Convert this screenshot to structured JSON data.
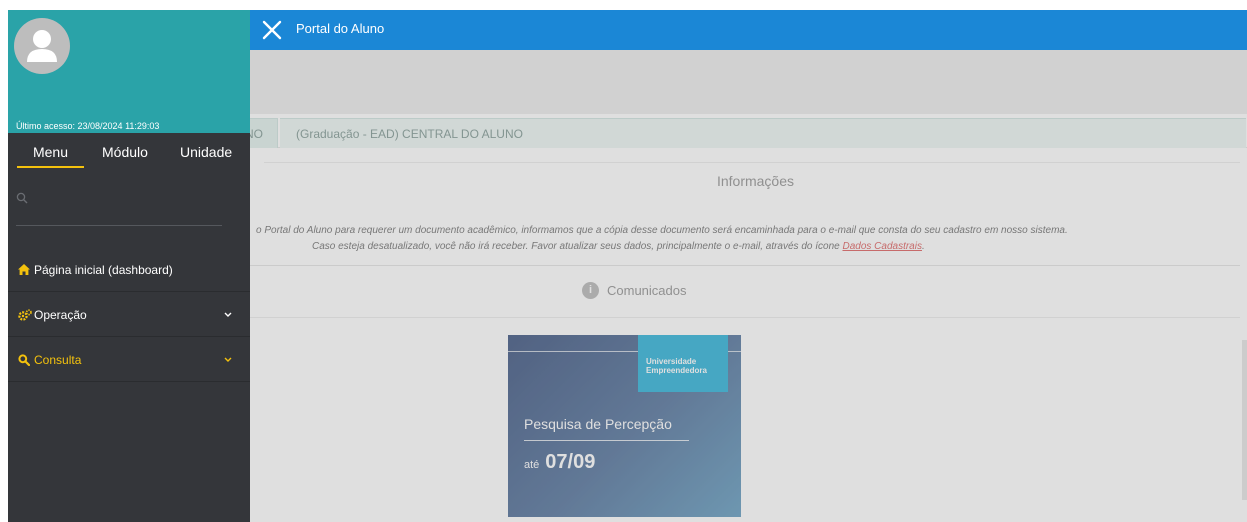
{
  "topbar": {
    "title": "Portal do Aluno"
  },
  "tabs": [
    {
      "label": "NO"
    },
    {
      "label": "(Graduação - EAD) CENTRAL DO ALUNO"
    }
  ],
  "info": {
    "heading": "Informações",
    "line1": "o Portal do Aluno para requerer um documento acadêmico, informamos que a cópia desse documento será encaminhada para o e-mail que consta do seu cadastro em nosso sistema.",
    "line2": "Caso esteja desatualizado, você não irá receber. Favor atualizar seus dados, principalmente o e-mail, através do ícone",
    "link": "Dados Cadastrais",
    "end": "."
  },
  "comunicados": {
    "heading": "Comunicados"
  },
  "banner": {
    "logo_text": "Universidade Empreendedora",
    "title": "Pesquisa de Percepção",
    "ate_label": "até",
    "date": "07/09"
  },
  "sidebar": {
    "last_access": "Último acesso: 23/08/2024 11:29:03",
    "tabs": [
      "Menu",
      "Módulo",
      "Unidade"
    ],
    "search_placeholder": "",
    "items": [
      {
        "label": "Página inicial (dashboard)",
        "icon": "home-icon"
      },
      {
        "label": "Operação",
        "icon": "gears-icon"
      },
      {
        "label": "Consulta",
        "icon": "search-icon"
      }
    ]
  },
  "colors": {
    "topbar": "#1b87d6",
    "sidebar_header": "#2aa3a8",
    "sidebar": "#34363a",
    "accent": "#f4c20d"
  }
}
